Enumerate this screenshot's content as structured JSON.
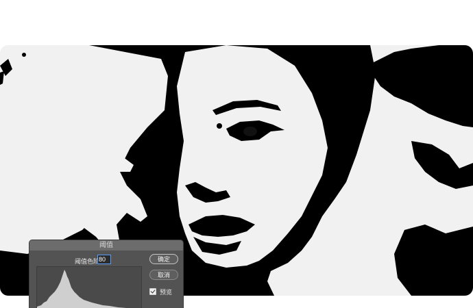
{
  "dialog": {
    "title": "阈值",
    "threshold_label": "阈值色阶:",
    "threshold_value": "80",
    "ok_label": "确定",
    "cancel_label": "取消",
    "preview_label": "预览",
    "preview_checked": true
  },
  "colors": {
    "canvas_background": "#f1f1f1",
    "ink": "#000000",
    "dialog_background": "#535353",
    "dialog_titlebar": "#6c6c6c"
  },
  "icons": {
    "preview_checkbox": "checkbox-checked-icon"
  }
}
